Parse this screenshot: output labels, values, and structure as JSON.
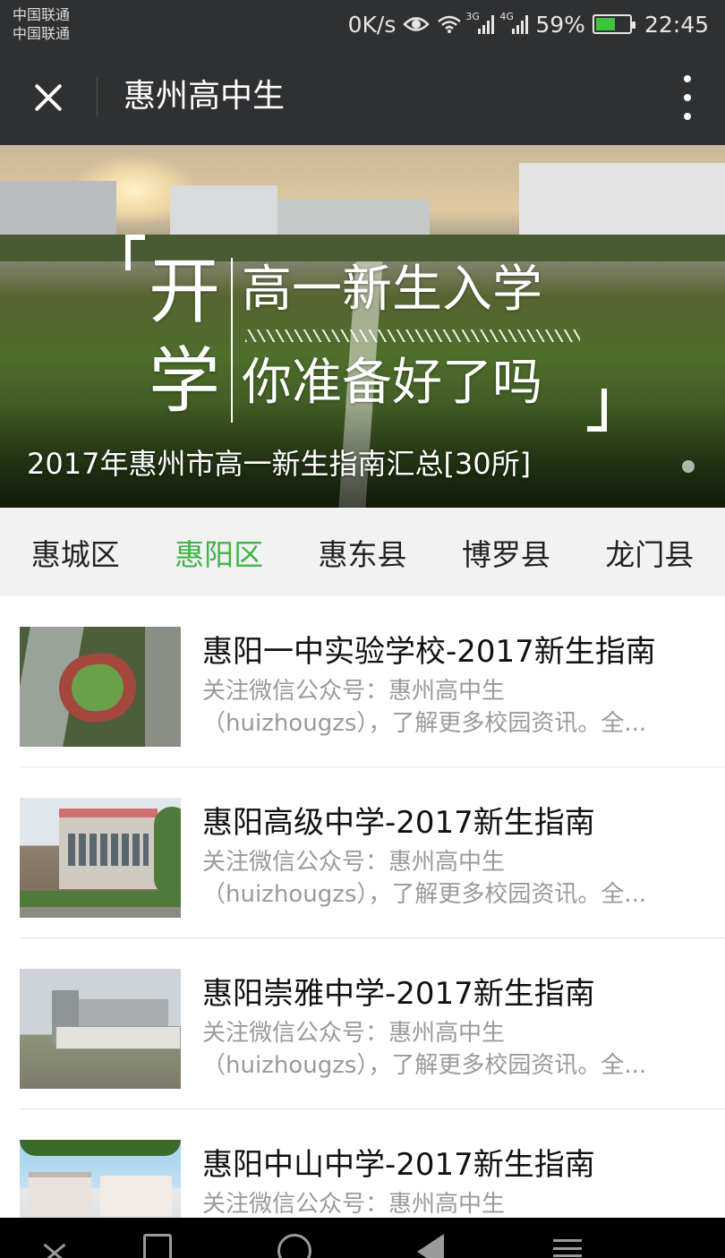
{
  "status_bar": {
    "carrier_1": "中国联通",
    "carrier_2": "中国联通",
    "net_speed": "0K/s",
    "signal_1_tag": "3G",
    "signal_2_tag": "4G",
    "battery": "59%",
    "time": "22:45",
    "icons": [
      "eye-icon",
      "wifi-icon",
      "signal-icon",
      "battery-charging-icon"
    ]
  },
  "top_bar": {
    "title": "惠州高中生",
    "close_icon": "close-icon",
    "more_icon": "more-vertical-icon"
  },
  "banner": {
    "big_char_1": "开",
    "big_char_2": "学",
    "slogan_1": "高一新生入学",
    "slogan_2": "你准备好了吗",
    "caption": "2017年惠州市高一新生指南汇总[30所]",
    "page_indicator": "1/1"
  },
  "tabs": [
    {
      "label": "惠城区",
      "active": false
    },
    {
      "label": "惠阳区",
      "active": true
    },
    {
      "label": "惠东县",
      "active": false
    },
    {
      "label": "博罗县",
      "active": false
    },
    {
      "label": "龙门县",
      "active": false
    }
  ],
  "articles": [
    {
      "title": "惠阳一中实验学校-2017新生指南",
      "desc_line1": "关注微信公众号：惠州高中生",
      "desc_line2": "（huizhougzs），了解更多校园资讯。全..."
    },
    {
      "title": "惠阳高级中学-2017新生指南",
      "desc_line1": "关注微信公众号：惠州高中生",
      "desc_line2": "（huizhougzs），了解更多校园资讯。全..."
    },
    {
      "title": "惠阳崇雅中学-2017新生指南",
      "desc_line1": "关注微信公众号：惠州高中生",
      "desc_line2": "（huizhougzs），了解更多校园资讯。全..."
    },
    {
      "title": "惠阳中山中学-2017新生指南",
      "desc_line1": "关注微信公众号：惠州高中生",
      "desc_line2": ""
    }
  ],
  "nav_bar": {
    "icons": [
      "collapse-icon",
      "square-icon",
      "home-circle-icon",
      "back-triangle-icon",
      "menu-icon"
    ]
  },
  "colors": {
    "bar_bg": "#2f3032",
    "accent_green": "#3fb446",
    "tab_bg": "#f2f2f2",
    "desc_gray": "#9a9a9a"
  }
}
